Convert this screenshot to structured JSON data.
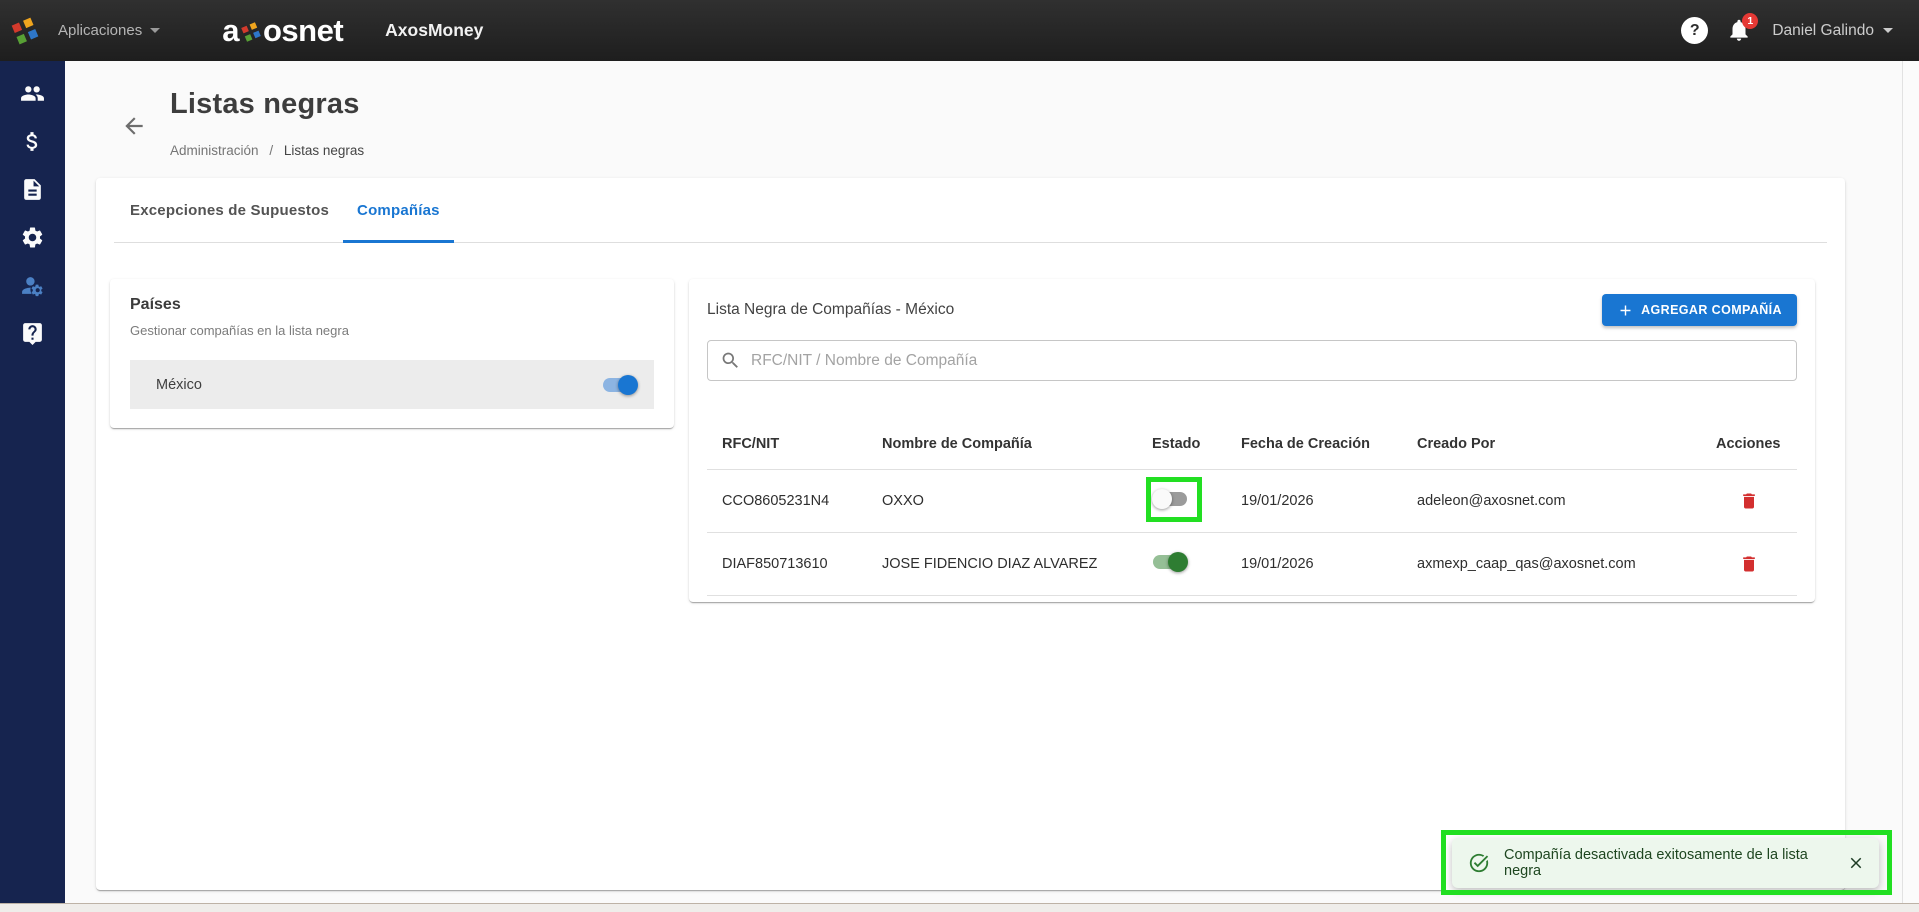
{
  "topbar": {
    "apps_menu_label": "Aplicaciones",
    "logo_prefix": "a",
    "logo_suffix": "osnet",
    "app_name": "AxosMoney",
    "help_glyph": "?",
    "notification_count": "1",
    "user_name": "Daniel Galindo"
  },
  "sidebar": {
    "items": [
      {
        "icon": "people",
        "active": false
      },
      {
        "icon": "money",
        "active": false
      },
      {
        "icon": "documents",
        "active": false
      },
      {
        "icon": "settings",
        "active": false
      },
      {
        "icon": "user-management",
        "active": true
      },
      {
        "icon": "help",
        "active": false
      }
    ]
  },
  "page": {
    "title": "Listas negras",
    "breadcrumb_parent": "Administración",
    "breadcrumb_separator": "/",
    "breadcrumb_current": "Listas negras"
  },
  "tabs": [
    {
      "label": "Excepciones de Supuestos",
      "active": false
    },
    {
      "label": "Compañías",
      "active": true
    }
  ],
  "countries_panel": {
    "title": "Países",
    "subtitle": "Gestionar compañías en la lista negra",
    "items": [
      {
        "name": "México",
        "enabled": true
      }
    ]
  },
  "blacklist_panel": {
    "title": "Lista Negra de Compañías - México",
    "add_button_label": "AGREGAR COMPAÑÍA",
    "search_placeholder": "RFC/NIT / Nombre de Compañía",
    "columns": [
      "RFC/NIT",
      "Nombre de Compañía",
      "Estado",
      "Fecha de Creación",
      "Creado Por",
      "Acciones"
    ],
    "rows": [
      {
        "rfc": "CCO8605231N4",
        "company": "OXXO",
        "enabled": false,
        "created_date": "19/01/2026",
        "created_by": "adeleon@axosnet.com"
      },
      {
        "rfc": "DIAF850713610",
        "company": "JOSE FIDENCIO DIAZ ALVAREZ",
        "enabled": true,
        "created_date": "19/01/2026",
        "created_by": "axmexp_caap_qas@axosnet.com"
      }
    ]
  },
  "toast": {
    "message": "Compañía desactivada exitosamente de la lista negra"
  },
  "colors": {
    "accent_blue": "#1976d2",
    "success_green": "#2e7d32",
    "danger_red": "#d32f2f",
    "annotation_green": "#22df22",
    "sidebar_navy": "#16244f",
    "topbar_dark": "#232323"
  }
}
